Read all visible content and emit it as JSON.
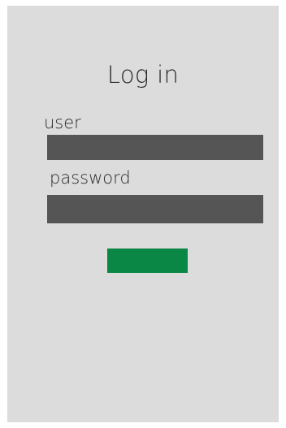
{
  "login": {
    "title": "Log in",
    "user_label": "user",
    "password_label": "password",
    "user_value": "",
    "password_value": "",
    "button_label": ""
  },
  "colors": {
    "background": "#dcdcdc",
    "field": "#555555",
    "button": "#0a8744"
  }
}
